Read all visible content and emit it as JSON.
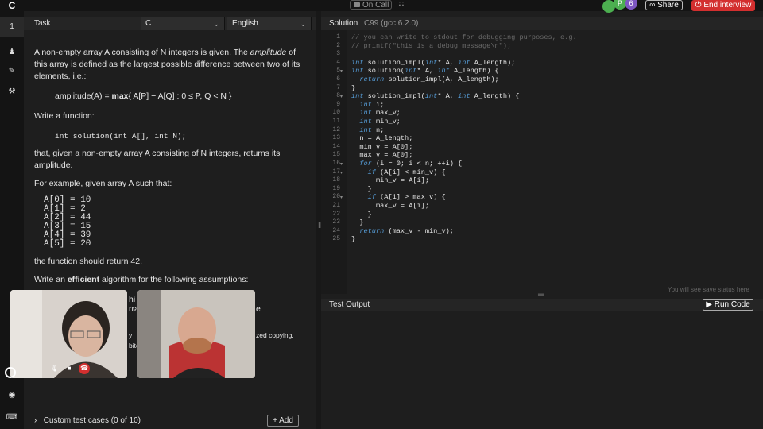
{
  "topbar": {
    "logo": "C",
    "on_call": "On Call",
    "share": "Share",
    "end_interview": "End interview",
    "avatars": [
      {
        "label": "",
        "color": "#4caf50"
      },
      {
        "label": "P",
        "color": "#4caf50"
      },
      {
        "label": "6",
        "color": "#7e57c2"
      }
    ]
  },
  "rail": {
    "items": [
      {
        "name": "task-number",
        "label": "1"
      },
      {
        "name": "user-icon",
        "label": "♟"
      },
      {
        "name": "edit-icon",
        "label": "✎"
      },
      {
        "name": "tools-icon",
        "label": "⚒"
      },
      {
        "name": "eye-icon",
        "label": "◉"
      },
      {
        "name": "keyboard-icon",
        "label": "⌨"
      }
    ]
  },
  "task": {
    "header_label": "Task",
    "language_value": "C",
    "locale_value": "English",
    "intro_line1": "A non-empty array A consisting of N integers is given. The ",
    "intro_em": "amplitude",
    "intro_line1b": " of",
    "intro_line2": "this array is defined as the largest possible difference between two of its",
    "intro_line3": "elements, i.e.:",
    "formula_prefix": "amplitude(A) = ",
    "formula_bold": "max",
    "formula_rest": "{ A[P] − A[Q] : 0 ≤ P, Q < N }",
    "write_function": "Write a function:",
    "signature": "int solution(int A[], int N);",
    "returns_line1": "that, given a non-empty array A consisting of N integers, returns its",
    "returns_line2": "amplitude.",
    "example_intro": "For example, given array A such that:",
    "array_lines": [
      "A[0] = 10",
      "A[1] = 2",
      "A[2] = 44",
      "A[3] = 15",
      "A[4] = 39",
      "A[5] = 20"
    ],
    "should_return": "the function should return 42.",
    "efficient_prefix": "Write an ",
    "efficient_bold": "efficient",
    "efficient_suffix": " algorithm for the following assumptions:",
    "partial1": "hi",
    "partial2": "rra",
    "partial3": "e",
    "partial4": "zed copying,",
    "partial5": "y",
    "partial6": "bite",
    "custom_cases": "Custom test cases (0 of 10)",
    "add_button": "+ Add"
  },
  "editor": {
    "solution_label": "Solution",
    "language_label": "C99 (gcc 6.2.0)",
    "save_status": "You will see save status here",
    "lines": [
      "// you can write to stdout for debugging purposes, e.g.",
      "// printf(\"this is a debug message\\n\");",
      "",
      "int solution_impl(int* A, int A_length);",
      "int solution(int* A, int A_length) {",
      "  return solution_impl(A, A_length);",
      "}",
      "int solution_impl(int* A, int A_length) {",
      "  int i;",
      "  int max_v;",
      "  int min_v;",
      "  int n;",
      "  n = A_length;",
      "  min_v = A[0];",
      "  max_v = A[0];",
      "  for (i = 0; i < n; ++i) {",
      "    if (A[i] < min_v) {",
      "      min_v = A[i];",
      "    }",
      "    if (A[i] > max_v) {",
      "      max_v = A[i];",
      "    }",
      "  }",
      "  return (max_v - min_v);",
      "}"
    ],
    "line_numbers": [
      "1",
      "2",
      "3",
      "4",
      "5",
      "6",
      "7",
      "8",
      "9",
      "10",
      "11",
      "12",
      "13",
      "14",
      "15",
      "16",
      "17",
      "18",
      "19",
      "20",
      "21",
      "22",
      "23",
      "24",
      "25"
    ]
  },
  "output": {
    "label": "Test Output",
    "run_button": "▶ Run Code"
  },
  "colors": {
    "end_interview_bg": "#d32f2f",
    "keyword": "#569cd6",
    "comment": "#6a6a6a"
  }
}
